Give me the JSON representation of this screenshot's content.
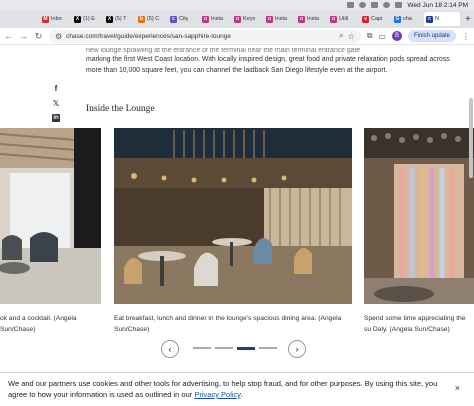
{
  "menubar": {
    "datetime": "Wed Jun 18  2:14 PM"
  },
  "tabs": [
    {
      "label": "Inbo",
      "color": "#d93025",
      "glyph": "M"
    },
    {
      "label": "(1) E",
      "color": "#000000",
      "glyph": "X"
    },
    {
      "label": "(5) T",
      "color": "#000000",
      "glyph": "X"
    },
    {
      "label": "(5) C",
      "color": "#e8710a",
      "glyph": "b"
    },
    {
      "label": "City",
      "color": "#6b4fbb",
      "glyph": "c"
    },
    {
      "label": "Insta",
      "color": "#c13584",
      "glyph": "o"
    },
    {
      "label": "Keys",
      "color": "#c13584",
      "glyph": "o"
    },
    {
      "label": "Insta",
      "color": "#c13584",
      "glyph": "o"
    },
    {
      "label": "Insta",
      "color": "#c13584",
      "glyph": "o"
    },
    {
      "label": "Utili",
      "color": "#c13584",
      "glyph": "o"
    },
    {
      "label": "Capi",
      "color": "#d6242f",
      "glyph": "v"
    },
    {
      "label": "cha",
      "color": "#1a73e8",
      "glyph": "G"
    },
    {
      "label": "N",
      "color": "#1c3f8c",
      "glyph": "c",
      "active": true
    }
  ],
  "toolbar": {
    "url": "chase.com/travel/guide/experiences/san-sapphire-lounge",
    "update_label": "Finish update",
    "avatar_initial": "B"
  },
  "article": {
    "intro": "marking the first West Coast location. With locally inspired design, great food and private relaxation pods spread across more than 10,000 square feet, you can channel the laidback San Diego lifestyle even at the airport.",
    "intro_top": "new lounge sprawling at the entrance of the terminal near the main terminal entrance gate",
    "section_title": "Inside the Lounge",
    "captions": [
      "ok and a cocktail. (Angela Sun/Chase)",
      "Eat breakfast, lunch and dinner in the lounge's spacious dining area. (Angela Sun/Chase)",
      "Spend some time appreciating the su Daly. (Angela Sun/Chase)"
    ],
    "social": [
      "facebook-icon",
      "x-icon",
      "linkedin-icon"
    ]
  },
  "carousel": {
    "prev_glyph": "‹",
    "next_glyph": "›",
    "dot_count": 4,
    "active_dot": 2
  },
  "cookie": {
    "text": "We and our partners use cookies and other tools for advertising, to help stop fraud, and for other purposes. By using this site, you agree to how your information is used as outlined in our ",
    "link": "Privacy Policy",
    "suffix": ".",
    "close": "×"
  }
}
